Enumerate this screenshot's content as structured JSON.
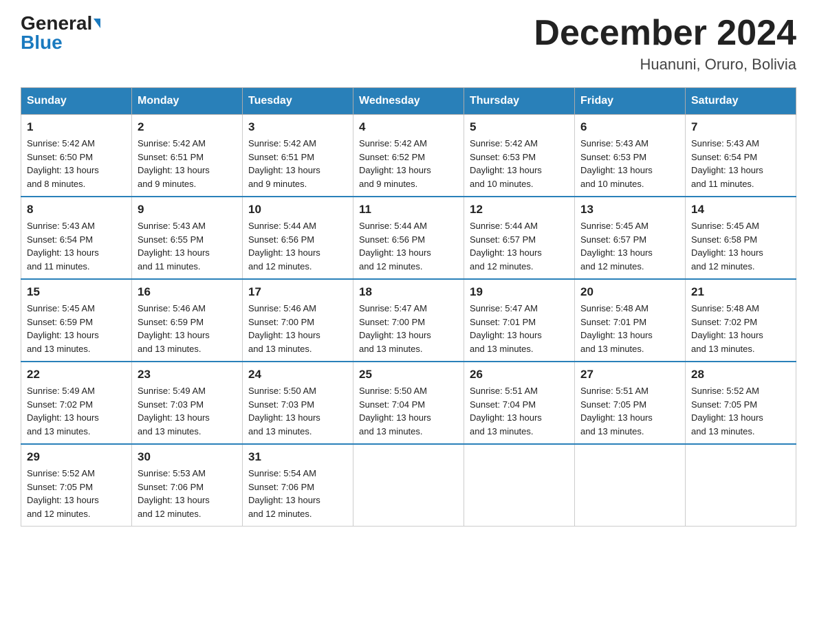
{
  "header": {
    "logo_general": "General",
    "logo_blue": "Blue",
    "month_title": "December 2024",
    "location": "Huanuni, Oruro, Bolivia"
  },
  "days_of_week": [
    "Sunday",
    "Monday",
    "Tuesday",
    "Wednesday",
    "Thursday",
    "Friday",
    "Saturday"
  ],
  "weeks": [
    [
      {
        "day": "1",
        "sunrise": "5:42 AM",
        "sunset": "6:50 PM",
        "daylight": "13 hours and 8 minutes."
      },
      {
        "day": "2",
        "sunrise": "5:42 AM",
        "sunset": "6:51 PM",
        "daylight": "13 hours and 9 minutes."
      },
      {
        "day": "3",
        "sunrise": "5:42 AM",
        "sunset": "6:51 PM",
        "daylight": "13 hours and 9 minutes."
      },
      {
        "day": "4",
        "sunrise": "5:42 AM",
        "sunset": "6:52 PM",
        "daylight": "13 hours and 9 minutes."
      },
      {
        "day": "5",
        "sunrise": "5:42 AM",
        "sunset": "6:53 PM",
        "daylight": "13 hours and 10 minutes."
      },
      {
        "day": "6",
        "sunrise": "5:43 AM",
        "sunset": "6:53 PM",
        "daylight": "13 hours and 10 minutes."
      },
      {
        "day": "7",
        "sunrise": "5:43 AM",
        "sunset": "6:54 PM",
        "daylight": "13 hours and 11 minutes."
      }
    ],
    [
      {
        "day": "8",
        "sunrise": "5:43 AM",
        "sunset": "6:54 PM",
        "daylight": "13 hours and 11 minutes."
      },
      {
        "day": "9",
        "sunrise": "5:43 AM",
        "sunset": "6:55 PM",
        "daylight": "13 hours and 11 minutes."
      },
      {
        "day": "10",
        "sunrise": "5:44 AM",
        "sunset": "6:56 PM",
        "daylight": "13 hours and 12 minutes."
      },
      {
        "day": "11",
        "sunrise": "5:44 AM",
        "sunset": "6:56 PM",
        "daylight": "13 hours and 12 minutes."
      },
      {
        "day": "12",
        "sunrise": "5:44 AM",
        "sunset": "6:57 PM",
        "daylight": "13 hours and 12 minutes."
      },
      {
        "day": "13",
        "sunrise": "5:45 AM",
        "sunset": "6:57 PM",
        "daylight": "13 hours and 12 minutes."
      },
      {
        "day": "14",
        "sunrise": "5:45 AM",
        "sunset": "6:58 PM",
        "daylight": "13 hours and 12 minutes."
      }
    ],
    [
      {
        "day": "15",
        "sunrise": "5:45 AM",
        "sunset": "6:59 PM",
        "daylight": "13 hours and 13 minutes."
      },
      {
        "day": "16",
        "sunrise": "5:46 AM",
        "sunset": "6:59 PM",
        "daylight": "13 hours and 13 minutes."
      },
      {
        "day": "17",
        "sunrise": "5:46 AM",
        "sunset": "7:00 PM",
        "daylight": "13 hours and 13 minutes."
      },
      {
        "day": "18",
        "sunrise": "5:47 AM",
        "sunset": "7:00 PM",
        "daylight": "13 hours and 13 minutes."
      },
      {
        "day": "19",
        "sunrise": "5:47 AM",
        "sunset": "7:01 PM",
        "daylight": "13 hours and 13 minutes."
      },
      {
        "day": "20",
        "sunrise": "5:48 AM",
        "sunset": "7:01 PM",
        "daylight": "13 hours and 13 minutes."
      },
      {
        "day": "21",
        "sunrise": "5:48 AM",
        "sunset": "7:02 PM",
        "daylight": "13 hours and 13 minutes."
      }
    ],
    [
      {
        "day": "22",
        "sunrise": "5:49 AM",
        "sunset": "7:02 PM",
        "daylight": "13 hours and 13 minutes."
      },
      {
        "day": "23",
        "sunrise": "5:49 AM",
        "sunset": "7:03 PM",
        "daylight": "13 hours and 13 minutes."
      },
      {
        "day": "24",
        "sunrise": "5:50 AM",
        "sunset": "7:03 PM",
        "daylight": "13 hours and 13 minutes."
      },
      {
        "day": "25",
        "sunrise": "5:50 AM",
        "sunset": "7:04 PM",
        "daylight": "13 hours and 13 minutes."
      },
      {
        "day": "26",
        "sunrise": "5:51 AM",
        "sunset": "7:04 PM",
        "daylight": "13 hours and 13 minutes."
      },
      {
        "day": "27",
        "sunrise": "5:51 AM",
        "sunset": "7:05 PM",
        "daylight": "13 hours and 13 minutes."
      },
      {
        "day": "28",
        "sunrise": "5:52 AM",
        "sunset": "7:05 PM",
        "daylight": "13 hours and 13 minutes."
      }
    ],
    [
      {
        "day": "29",
        "sunrise": "5:52 AM",
        "sunset": "7:05 PM",
        "daylight": "13 hours and 12 minutes."
      },
      {
        "day": "30",
        "sunrise": "5:53 AM",
        "sunset": "7:06 PM",
        "daylight": "13 hours and 12 minutes."
      },
      {
        "day": "31",
        "sunrise": "5:54 AM",
        "sunset": "7:06 PM",
        "daylight": "13 hours and 12 minutes."
      },
      null,
      null,
      null,
      null
    ]
  ],
  "labels": {
    "sunrise": "Sunrise:",
    "sunset": "Sunset:",
    "daylight": "Daylight:"
  }
}
